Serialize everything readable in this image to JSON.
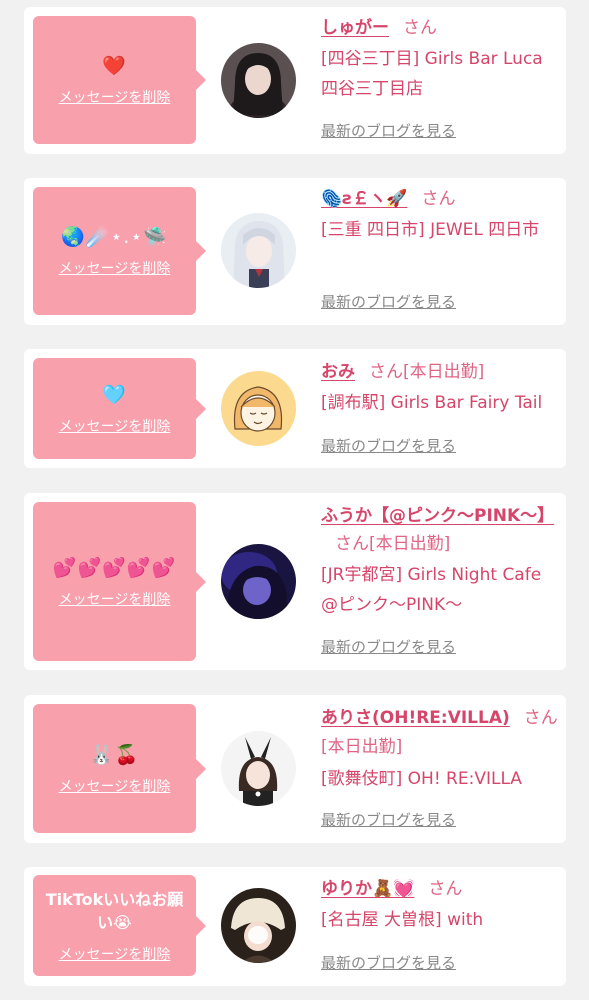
{
  "common": {
    "delete_label": "メッセージを削除",
    "blog_label": "最新のブログを見る",
    "san_label": "さん"
  },
  "colors": {
    "bubble": "#f9a0ad",
    "name": "#d6466b",
    "background": "#f1f1f1"
  },
  "cards": [
    {
      "message": "❤️",
      "name": "しゅがー",
      "status": "",
      "shop": "[四谷三丁目] Girls Bar Luca 四谷三丁目店",
      "avatar_icon": "avatar-dark-hair-girl"
    },
    {
      "message": "🌏☄️⋆.⋆🛸",
      "name": "🫆ƨ￡ヽ🚀",
      "status": "",
      "shop": "[三重 四日市] JEWEL 四日市",
      "avatar_icon": "avatar-silver-hair-girl"
    },
    {
      "message": "🩵",
      "name": "おみ",
      "status": "[本日出勤]",
      "shop": "[調布駅] Girls Bar Fairy Tail",
      "avatar_icon": "avatar-illustrated-girl"
    },
    {
      "message": "💕💕💕💕💕",
      "name": "ふうか【@ピンク〜PINK〜】",
      "status": "[本日出勤]",
      "shop": "[JR宇都宮] Girls Night Cafe @ピンク〜PINK〜",
      "avatar_icon": "avatar-purple-lit-girl"
    },
    {
      "message": "🐰🍒",
      "name": "ありさ(OH!RE:VILLA)",
      "status": "[本日出勤]",
      "shop": "[歌舞伎町] OH! RE:VILLA",
      "avatar_icon": "avatar-bunny-girl"
    },
    {
      "message": "TikTokいいねお願い😭",
      "name": "ゆりか🧸💓",
      "status": "",
      "shop": "[名古屋 大曽根] with",
      "avatar_icon": "avatar-cream-hat-girl"
    }
  ]
}
